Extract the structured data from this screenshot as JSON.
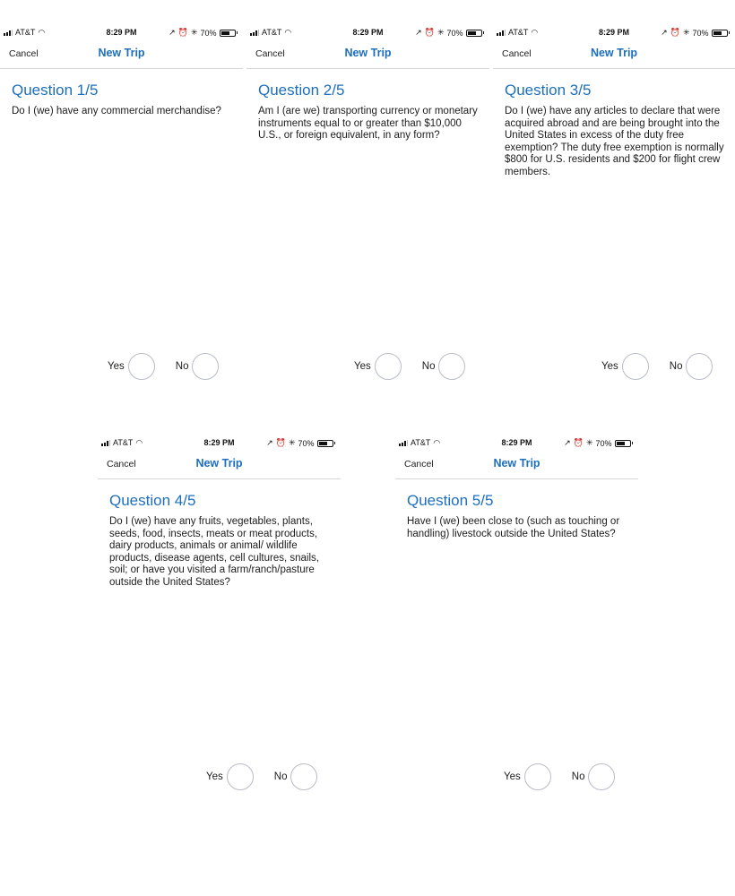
{
  "status_bar": {
    "carrier": "AT&T",
    "time": "8:29 PM",
    "battery_percent": "70%",
    "battery_level": 0.7,
    "icons": [
      "signal-icon",
      "wifi-icon",
      "location-arrow-icon",
      "alarm-icon",
      "bluetooth-icon",
      "battery-icon"
    ]
  },
  "nav": {
    "cancel_label": "Cancel",
    "title": "New Trip"
  },
  "answers": {
    "yes_label": "Yes",
    "no_label": "No"
  },
  "colors": {
    "accent": "#1d6fbd",
    "separator": "#d6d6d6",
    "radio_border": "#b9bcc7"
  },
  "questions": [
    {
      "title": "Question 1/5",
      "text": "Do I (we) have any commercial merchandise?"
    },
    {
      "title": "Question 2/5",
      "text": "Am I (are we) transporting currency or monetary instruments equal to or greater than $10,000 U.S., or foreign equivalent, in any form?"
    },
    {
      "title": "Question 3/5",
      "text": "Do I (we) have any articles to declare that were acquired abroad and are being brought into the United States in excess of the duty free exemption? The duty free exemption is normally $800 for U.S. residents and $200 for flight crew members."
    },
    {
      "title": "Question 4/5",
      "text": "Do I (we) have any fruits, vegetables, plants, seeds, food, insects, meats or meat products, dairy products, animals or animal/ wildlife products, disease agents, cell cultures, snails, soil; or have you visited a farm/ranch/pasture outside the United States?"
    },
    {
      "title": "Question 5/5",
      "text": "Have I (we) been close to (such as touching or handling) livestock outside the United States?"
    }
  ]
}
